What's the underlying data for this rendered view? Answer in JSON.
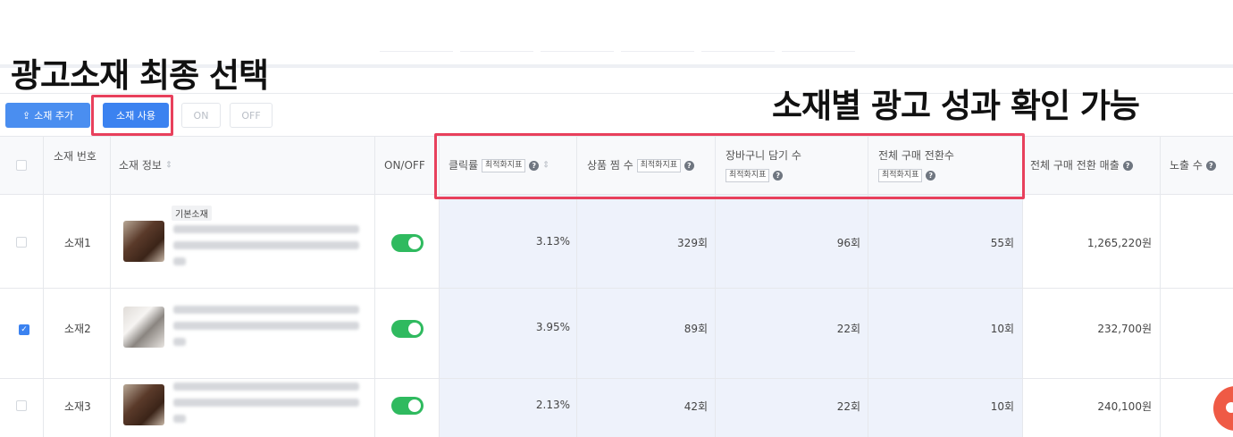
{
  "annotations": {
    "left": "광고소재 최종 선택",
    "right": "소재별 광고 성과 확인 가능"
  },
  "toolbar": {
    "add_label": "소재 추가",
    "use_label": "소재 사용",
    "on_label": "ON",
    "off_label": "OFF"
  },
  "columns": {
    "number": "소재 번호",
    "info": "소재 정보",
    "onoff": "ON/OFF",
    "ctr": "클릭률",
    "wish": "상품 찜 수",
    "cart": "장바구니 담기 수",
    "conversion": "전체 구매 전환수",
    "revenue": "전체 구매 전환 매출",
    "impressions": "노출 수",
    "badge": "최적화지표"
  },
  "rows": [
    {
      "name": "소재1",
      "tag": "기본소재",
      "ctr": "3.13%",
      "wish": "329회",
      "cart": "96회",
      "conversion": "55회",
      "revenue": "1,265,220원",
      "checked": false
    },
    {
      "name": "소재2",
      "tag": "",
      "ctr": "3.95%",
      "wish": "89회",
      "cart": "22회",
      "conversion": "10회",
      "revenue": "232,700원",
      "checked": true
    },
    {
      "name": "소재3",
      "tag": "",
      "ctr": "2.13%",
      "wish": "42회",
      "cart": "22회",
      "conversion": "10회",
      "revenue": "240,100원",
      "checked": false
    }
  ],
  "colors": {
    "primary": "#3b82f0",
    "annotation_frame": "#e8405c",
    "toggle_on": "#2fba5f",
    "highlight": "#eef2fb"
  }
}
